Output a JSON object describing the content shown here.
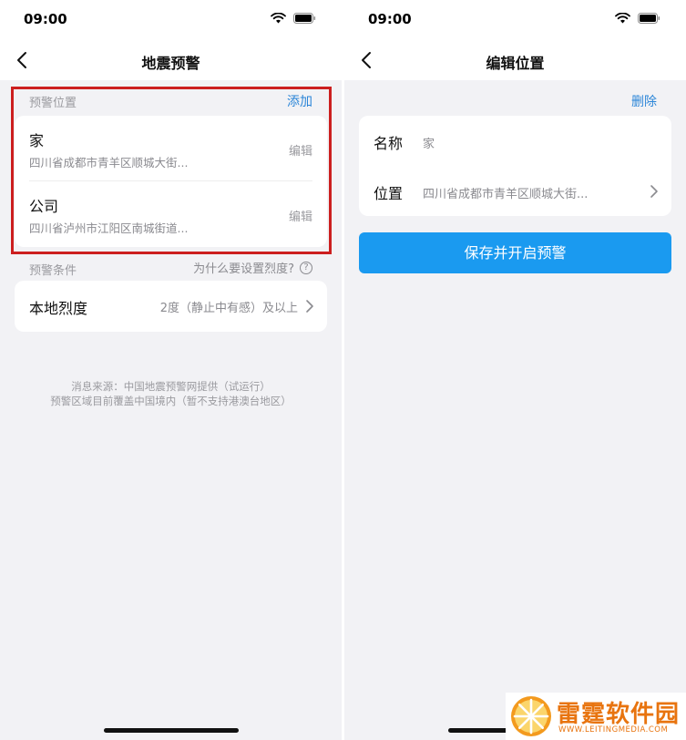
{
  "left": {
    "status_time": "09:00",
    "title": "地震预警",
    "locations_section_label": "预警位置",
    "add_label": "添加",
    "locations": [
      {
        "name": "家",
        "address": "四川省成都市青羊区顺城大街...",
        "edit_label": "编辑"
      },
      {
        "name": "公司",
        "address": "四川省泸州市江阳区南城街道...",
        "edit_label": "编辑"
      }
    ],
    "conditions_section_label": "预警条件",
    "why_label": "为什么要设置烈度?",
    "help_glyph": "?",
    "intensity_label": "本地烈度",
    "intensity_value": "2度（静止中有感）及以上",
    "footer_line1": "消息来源：中国地震预警网提供（试运行）",
    "footer_line2": "预警区域目前覆盖中国境内（暂不支持港澳台地区）"
  },
  "right": {
    "status_time": "09:00",
    "title": "编辑位置",
    "delete_label": "删除",
    "name_label": "名称",
    "name_value": "家",
    "location_label": "位置",
    "location_value": "四川省成都市青羊区顺城大街...",
    "save_button_label": "保存并开启预警"
  },
  "watermark": {
    "title": "雷霆软件园",
    "url": "WWW.LEITINGMEDIA.COM"
  },
  "colors": {
    "accent_blue": "#2c86d8",
    "button_blue": "#1a9af0",
    "highlight_red": "#cc1f1f",
    "background_gray": "#f2f2f5",
    "watermark_orange": "#e8740f"
  }
}
